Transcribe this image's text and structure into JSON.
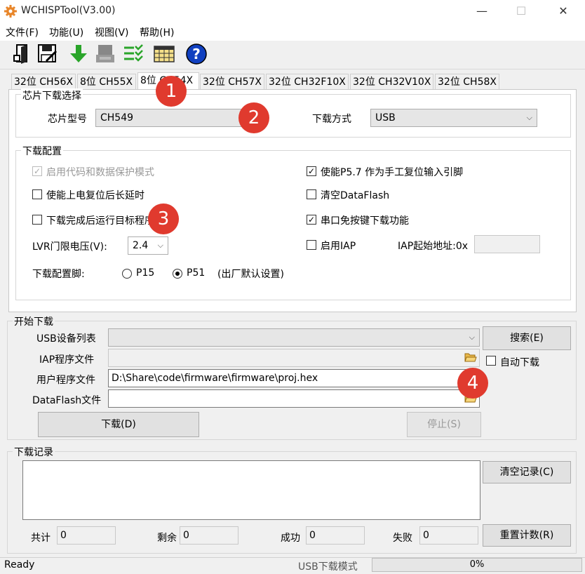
{
  "window": {
    "title": "WCHISPTool(V3.00)",
    "minimize": "—",
    "maximize": "☐",
    "close": "✕"
  },
  "menu": [
    "文件(F)",
    "功能(U)",
    "视图(V)",
    "帮助(H)"
  ],
  "toolbar_icons": [
    "open-icon",
    "save-icon",
    "download-icon",
    "chip-icon",
    "list-check-icon",
    "calendar-grid-icon",
    "help-icon"
  ],
  "tabs": [
    "32位 CH56X",
    "8位 CH55X",
    "8位 CH54X",
    "32位 CH57X",
    "32位 CH32F10X",
    "32位 CH32V10X",
    "32位 CH58X"
  ],
  "chip_select": {
    "group_label": "芯片下载选择",
    "chip_label": "芯片型号",
    "chip_value": "CH549",
    "mode_label": "下载方式",
    "mode_value": "USB"
  },
  "config": {
    "group_label": "下载配置",
    "opt_protect": "启用代码和数据保护模式",
    "opt_delay": "使能上电复位后长延时",
    "opt_run": "下载完成后运行目标程序",
    "lvr_label": "LVR门限电压(V):",
    "lvr_value": "2.4",
    "pin_label": "下载配置脚:",
    "pin_p15": "P15",
    "pin_p51": "P51",
    "pin_note": "(出厂默认设置)",
    "opt_p57": "使能P5.7 作为手工复位输入引脚",
    "opt_clear_df": "清空DataFlash",
    "opt_serial": "串口免按键下载功能",
    "opt_iap": "启用IAP",
    "iap_addr_label": "IAP起始地址:0x",
    "iap_addr_value": ""
  },
  "start": {
    "group_label": "开始下载",
    "usb_label": "USB设备列表",
    "usb_value": "",
    "search_btn": "搜索(E)",
    "iap_label": "IAP程序文件",
    "iap_value": "",
    "auto_label": "自动下载",
    "user_label": "用户程序文件",
    "user_value": "D:\\Share\\code\\firmware\\firmware\\proj.hex",
    "df_label": "DataFlash文件",
    "df_value": "",
    "download_btn": "下载(D)",
    "stop_btn": "停止(S)"
  },
  "log": {
    "group_label": "下载记录",
    "clear_btn": "清空记录(C)",
    "total_label": "共计",
    "total_value": "0",
    "remain_label": "剩余",
    "remain_value": "0",
    "success_label": "成功",
    "success_value": "0",
    "fail_label": "失败",
    "fail_value": "0",
    "reset_btn": "重置计数(R)"
  },
  "status": {
    "left": "Ready",
    "mode": "USB下载模式",
    "progress": "0%",
    "progress_value": 0
  },
  "badges": [
    "1",
    "2",
    "3",
    "4"
  ],
  "colors": {
    "badge": "#e03a2e",
    "help_blue": "#1040c0",
    "download_green": "#2aa52a"
  }
}
